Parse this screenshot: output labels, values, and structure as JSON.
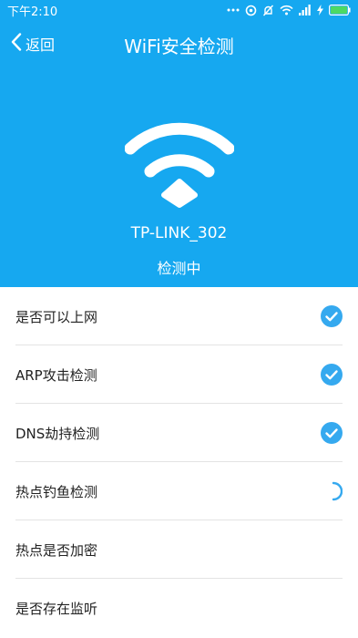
{
  "status_bar": {
    "time": "下午2:10",
    "icons": [
      "more-dots-icon",
      "sync-icon",
      "mute-bell-icon",
      "wifi-signal-icon",
      "cell-signal-icon",
      "charging-icon",
      "battery-icon"
    ],
    "battery_level": 1.0
  },
  "nav": {
    "back_label": "返回",
    "title": "WiFi安全检测"
  },
  "hero": {
    "ssid": "TP-LINK_302",
    "status": "检测中"
  },
  "checks": [
    {
      "label": "是否可以上网",
      "state": "passed"
    },
    {
      "label": "ARP攻击检测",
      "state": "passed"
    },
    {
      "label": "DNS劫持检测",
      "state": "passed"
    },
    {
      "label": "热点钓鱼检测",
      "state": "checking"
    },
    {
      "label": "热点是否加密",
      "state": "pending"
    },
    {
      "label": "是否存在监听",
      "state": "pending"
    }
  ],
  "colors": {
    "header_bg": "#16a8f0",
    "check_blue": "#35a9ef",
    "battery_green": "#4cd964"
  }
}
